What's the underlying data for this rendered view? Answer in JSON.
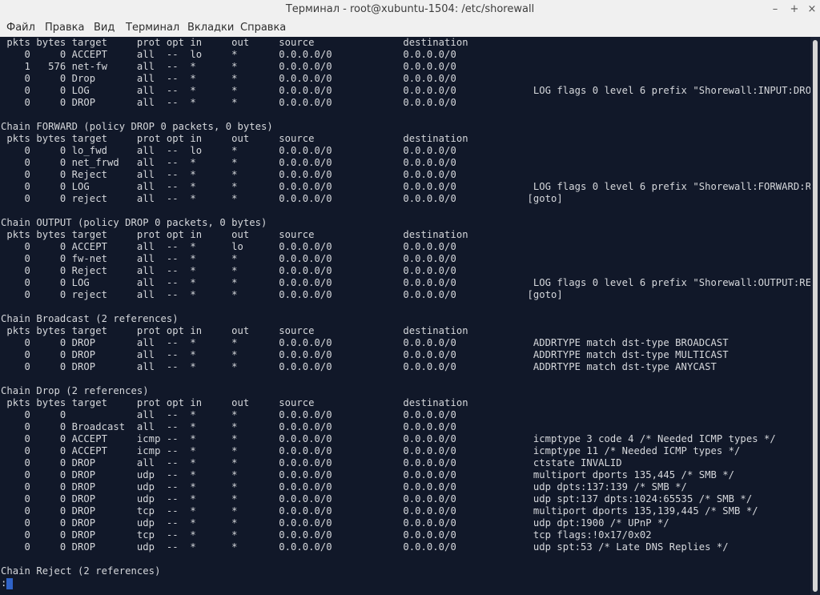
{
  "window": {
    "title": "Терминал - root@xubuntu-1504: /etc/shorewall",
    "minimize_glyph": "–",
    "maximize_glyph": "+",
    "close_glyph": "×"
  },
  "menu": {
    "items": [
      "Файл",
      "Правка",
      "Вид",
      "Терминал",
      "Вкладки",
      "Справка"
    ]
  },
  "terminal": {
    "lines": [
      " pkts bytes target     prot opt in     out     source               destination",
      "    0     0 ACCEPT     all  --  lo     *       0.0.0.0/0            0.0.0.0/0",
      "    1   576 net-fw     all  --  *      *       0.0.0.0/0            0.0.0.0/0",
      "    0     0 Drop       all  --  *      *       0.0.0.0/0            0.0.0.0/0",
      "    0     0 LOG        all  --  *      *       0.0.0.0/0            0.0.0.0/0             LOG flags 0 level 6 prefix \"Shorewall:INPUT:DROP:\"",
      "    0     0 DROP       all  --  *      *       0.0.0.0/0            0.0.0.0/0",
      "",
      "Chain FORWARD (policy DROP 0 packets, 0 bytes)",
      " pkts bytes target     prot opt in     out     source               destination",
      "    0     0 lo_fwd     all  --  lo     *       0.0.0.0/0            0.0.0.0/0",
      "    0     0 net_frwd   all  --  *      *       0.0.0.0/0            0.0.0.0/0",
      "    0     0 Reject     all  --  *      *       0.0.0.0/0            0.0.0.0/0",
      "    0     0 LOG        all  --  *      *       0.0.0.0/0            0.0.0.0/0             LOG flags 0 level 6 prefix \"Shorewall:FORWARD:REJECT:\"",
      "    0     0 reject     all  --  *      *       0.0.0.0/0            0.0.0.0/0            [goto]",
      "",
      "Chain OUTPUT (policy DROP 0 packets, 0 bytes)",
      " pkts bytes target     prot opt in     out     source               destination",
      "    0     0 ACCEPT     all  --  *      lo      0.0.0.0/0            0.0.0.0/0",
      "    0     0 fw-net     all  --  *      *       0.0.0.0/0            0.0.0.0/0",
      "    0     0 Reject     all  --  *      *       0.0.0.0/0            0.0.0.0/0",
      "    0     0 LOG        all  --  *      *       0.0.0.0/0            0.0.0.0/0             LOG flags 0 level 6 prefix \"Shorewall:OUTPUT:REJECT:\"",
      "    0     0 reject     all  --  *      *       0.0.0.0/0            0.0.0.0/0            [goto]",
      "",
      "Chain Broadcast (2 references)",
      " pkts bytes target     prot opt in     out     source               destination",
      "    0     0 DROP       all  --  *      *       0.0.0.0/0            0.0.0.0/0             ADDRTYPE match dst-type BROADCAST",
      "    0     0 DROP       all  --  *      *       0.0.0.0/0            0.0.0.0/0             ADDRTYPE match dst-type MULTICAST",
      "    0     0 DROP       all  --  *      *       0.0.0.0/0            0.0.0.0/0             ADDRTYPE match dst-type ANYCAST",
      "",
      "Chain Drop (2 references)",
      " pkts bytes target     prot opt in     out     source               destination",
      "    0     0            all  --  *      *       0.0.0.0/0            0.0.0.0/0",
      "    0     0 Broadcast  all  --  *      *       0.0.0.0/0            0.0.0.0/0",
      "    0     0 ACCEPT     icmp --  *      *       0.0.0.0/0            0.0.0.0/0             icmptype 3 code 4 /* Needed ICMP types */",
      "    0     0 ACCEPT     icmp --  *      *       0.0.0.0/0            0.0.0.0/0             icmptype 11 /* Needed ICMP types */",
      "    0     0 DROP       all  --  *      *       0.0.0.0/0            0.0.0.0/0             ctstate INVALID",
      "    0     0 DROP       udp  --  *      *       0.0.0.0/0            0.0.0.0/0             multiport dports 135,445 /* SMB */",
      "    0     0 DROP       udp  --  *      *       0.0.0.0/0            0.0.0.0/0             udp dpts:137:139 /* SMB */",
      "    0     0 DROP       udp  --  *      *       0.0.0.0/0            0.0.0.0/0             udp spt:137 dpts:1024:65535 /* SMB */",
      "    0     0 DROP       tcp  --  *      *       0.0.0.0/0            0.0.0.0/0             multiport dports 135,139,445 /* SMB */",
      "    0     0 DROP       udp  --  *      *       0.0.0.0/0            0.0.0.0/0             udp dpt:1900 /* UPnP */",
      "    0     0 DROP       tcp  --  *      *       0.0.0.0/0            0.0.0.0/0             tcp flags:!0x17/0x02",
      "    0     0 DROP       udp  --  *      *       0.0.0.0/0            0.0.0.0/0             udp spt:53 /* Late DNS Replies */",
      "",
      "Chain Reject (2 references)"
    ],
    "prompt": ":"
  },
  "colors": {
    "background": "#111829",
    "foreground": "#d6d8dc",
    "cursor": "#2f63c8",
    "chrome": "#f0f0f0"
  }
}
